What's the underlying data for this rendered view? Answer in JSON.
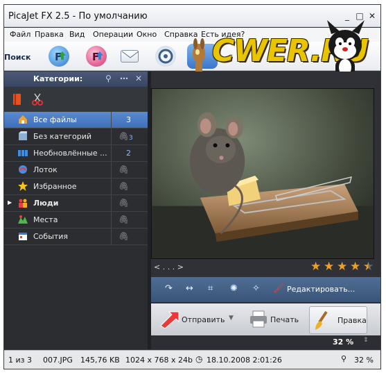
{
  "titlebar": {
    "title": "PicaJet FX 2.5  - По умолчанию",
    "min": "_",
    "max": "□",
    "close": "✕"
  },
  "menu": [
    "Файл",
    "Правка",
    "Вид",
    "Операции",
    "Окно",
    "Справка",
    "Есть идея?"
  ],
  "toolbar": {
    "search_label": "Поиск"
  },
  "logo": {
    "text": "CWER.RU"
  },
  "sidebar": {
    "header": "Категории:",
    "categories": [
      {
        "label": "Все файлы",
        "count": "3",
        "selected": true
      },
      {
        "label": "Без категорий",
        "count": "3"
      },
      {
        "label": "Необновлённые ...",
        "count": "2"
      },
      {
        "label": "Лоток",
        "count": ""
      },
      {
        "label": "Избранное",
        "count": ""
      },
      {
        "label": "Люди",
        "count": ""
      },
      {
        "label": "Места",
        "count": ""
      },
      {
        "label": "События",
        "count": ""
      }
    ]
  },
  "viewer": {
    "nav_text": "< . . . >",
    "rating": 4.5,
    "edit_label": "Редактировать...",
    "send_label": "Отправить",
    "print_label": "Печать",
    "edit_tab_label": "Правка",
    "zoom": "32 %"
  },
  "status": {
    "position": "1 из 3",
    "filename": "007.JPG",
    "filesize": "145,76 KB",
    "dimensions": "1024 x 768 x 24b",
    "datetime": "18.10.2008 2:01:26",
    "zoom": "32 %"
  },
  "colors": {
    "accent": "#3e6fb8",
    "count": "#8fb8ff",
    "star": "#f0a020",
    "dark_bg": "#33363d"
  }
}
